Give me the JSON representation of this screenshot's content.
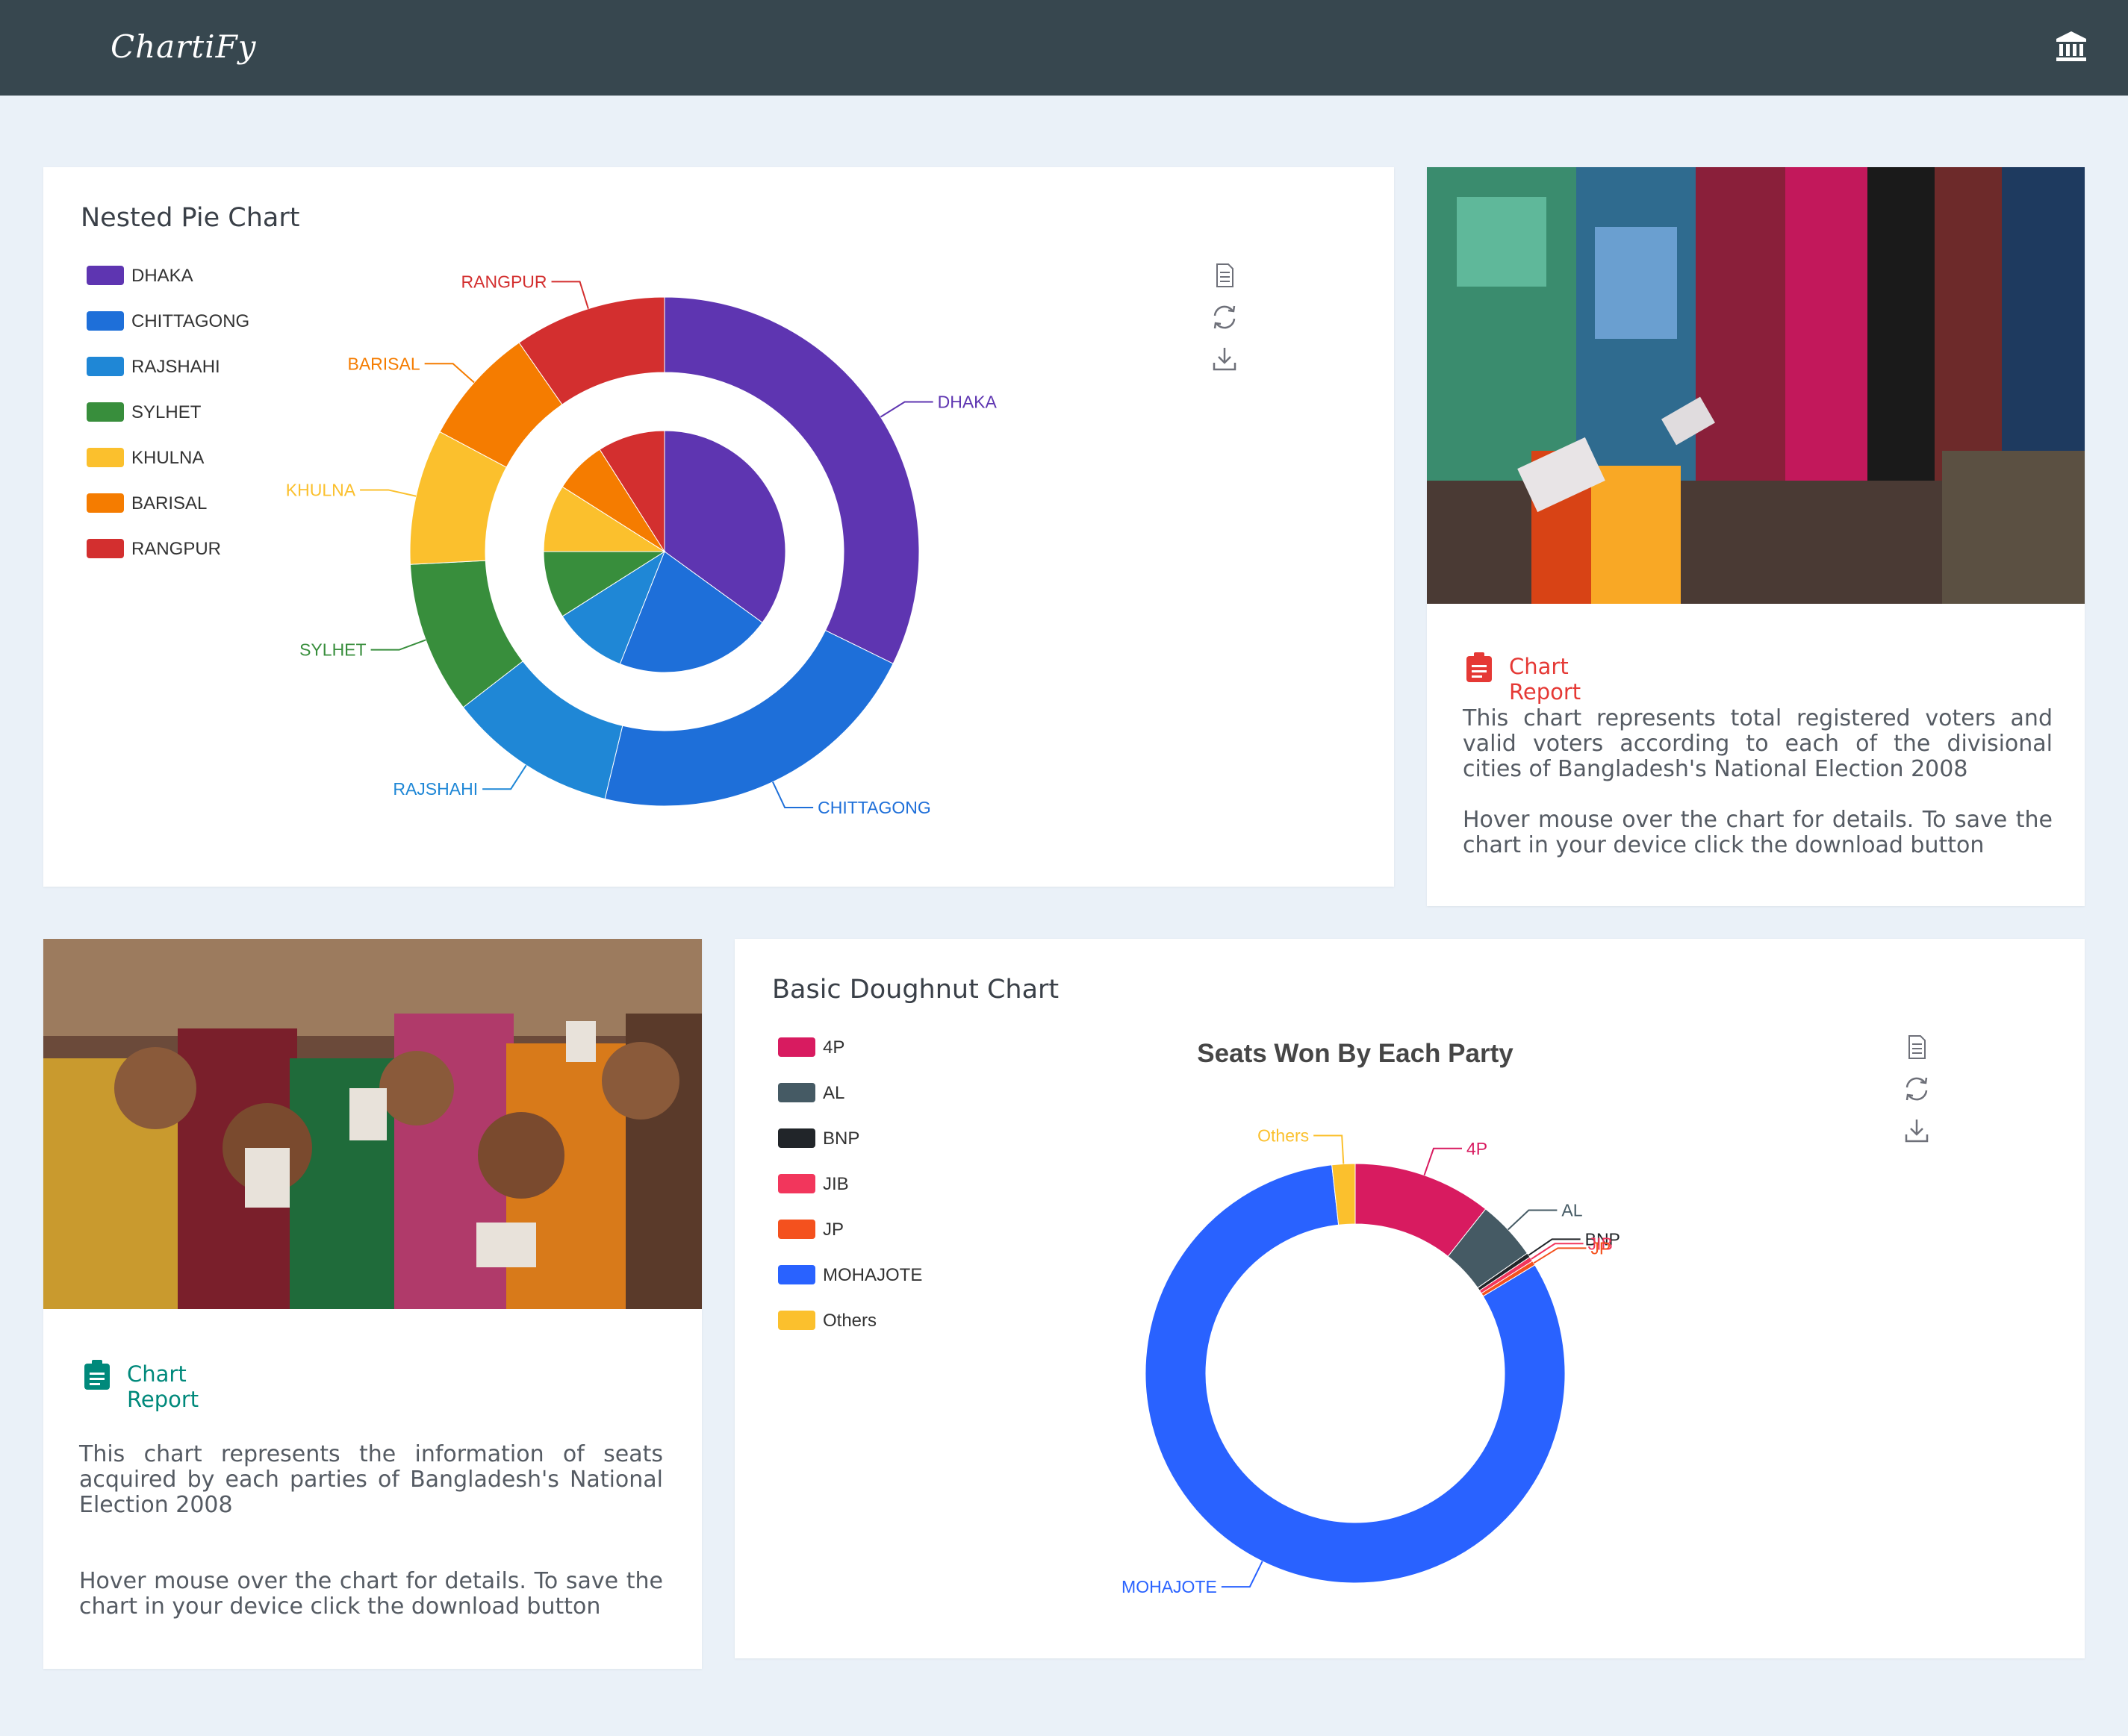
{
  "app": {
    "brand": "ChartiFy",
    "nav_icon": "bank-icon"
  },
  "nested_card": {
    "title": "Nested Pie Chart",
    "toolbox": [
      "data-view-icon",
      "restore-icon",
      "download-icon"
    ]
  },
  "report1": {
    "title": "Chart Report",
    "paragraph1": "This chart represents total registered voters and valid voters according to each of the divisional cities of Bangladesh's National Election 2008",
    "paragraph2": "Hover mouse over the chart for details. To save the chart in your device click the download button",
    "accent": "#e53935"
  },
  "report2": {
    "title": "Chart Report",
    "paragraph1": "This chart represents the information of seats acquired by each parties of Bangladesh's National Election 2008",
    "paragraph2": "Hover mouse over the chart for details. To save the chart in your device click the download button",
    "accent": "#00897b"
  },
  "doughnut_card": {
    "title": "Basic Doughnut Chart",
    "toolbox": [
      "data-view-icon",
      "restore-icon",
      "download-icon"
    ]
  },
  "chart_data": [
    {
      "type": "pie",
      "subtype": "nested",
      "title": "Nested Pie Chart",
      "legend": [
        "DHAKA",
        "CHITTAGONG",
        "RAJSHAHI",
        "SYLHET",
        "KHULNA",
        "BARISAL",
        "RANGPUR"
      ],
      "colors": [
        "#5e35b1",
        "#1e6fd9",
        "#1f87d6",
        "#388e3c",
        "#fbc02d",
        "#f57c00",
        "#d32f2f"
      ],
      "outer": [
        {
          "name": "DHAKA",
          "value": 30
        },
        {
          "name": "CHITTAGONG",
          "value": 20
        },
        {
          "name": "RAJSHAHI",
          "value": 10
        },
        {
          "name": "SYLHET",
          "value": 9
        },
        {
          "name": "KHULNA",
          "value": 8
        },
        {
          "name": "BARISAL",
          "value": 7
        },
        {
          "name": "RANGPUR",
          "value": 9
        }
      ],
      "inner": [
        {
          "name": "DHAKA",
          "value": 35
        },
        {
          "name": "CHITTAGONG",
          "value": 21
        },
        {
          "name": "RAJSHAHI",
          "value": 10
        },
        {
          "name": "SYLHET",
          "value": 9
        },
        {
          "name": "KHULNA",
          "value": 9
        },
        {
          "name": "BARISAL",
          "value": 7
        },
        {
          "name": "RANGPUR",
          "value": 9
        }
      ]
    },
    {
      "type": "pie",
      "subtype": "doughnut",
      "title": "Seats Won By Each Party",
      "legend": [
        "4P",
        "AL",
        "BNP",
        "JIB",
        "JP",
        "MOHAJOTE",
        "Others"
      ],
      "colors": [
        "#d81b60",
        "#455a64",
        "#212529",
        "#f2365c",
        "#f4511e",
        "#2962ff",
        "#fbc02d"
      ],
      "values": [
        {
          "name": "4P",
          "value": 30
        },
        {
          "name": "AL",
          "value": 13
        },
        {
          "name": "BNP",
          "value": 1
        },
        {
          "name": "JIB",
          "value": 1
        },
        {
          "name": "JP",
          "value": 1
        },
        {
          "name": "MOHAJOTE",
          "value": 230
        },
        {
          "name": "Others",
          "value": 5
        }
      ]
    }
  ]
}
